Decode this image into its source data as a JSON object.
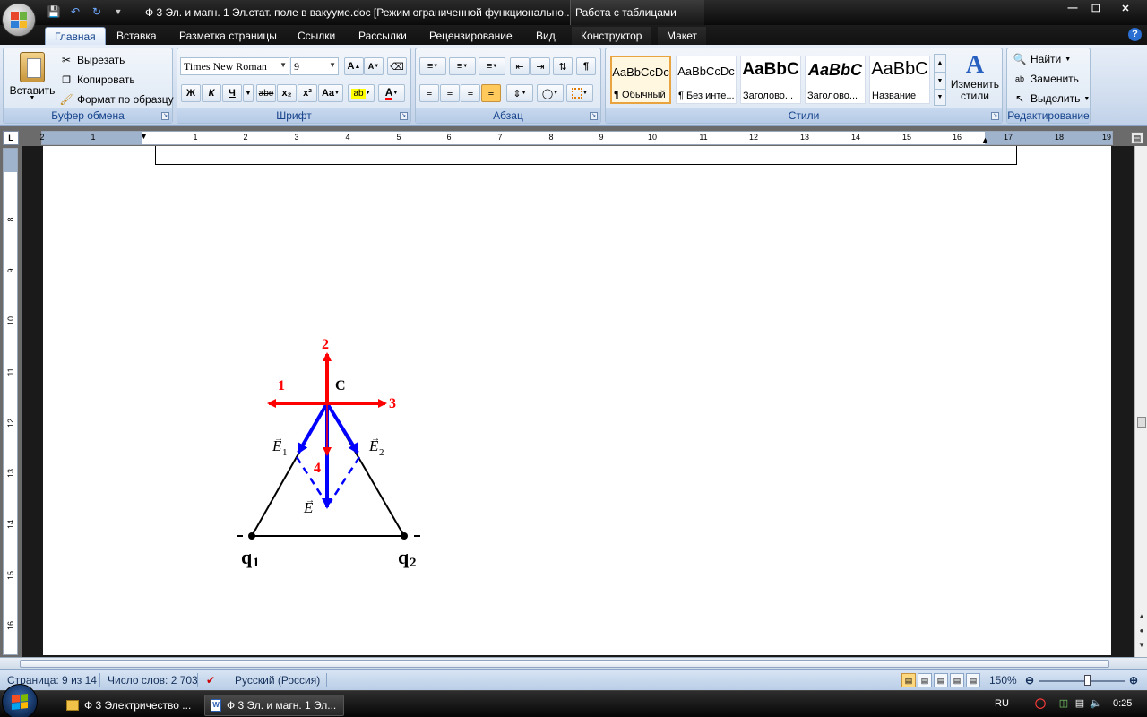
{
  "window": {
    "title": "Ф 3 Эл. и магн. 1 Эл.стат. поле в вакууме.doc [Режим ограниченной функционально...",
    "context_tab_group": "Работа с таблицами"
  },
  "tabs": [
    "Главная",
    "Вставка",
    "Разметка страницы",
    "Ссылки",
    "Рассылки",
    "Рецензирование",
    "Вид",
    "Конструктор",
    "Макет"
  ],
  "ribbon": {
    "clipboard": {
      "paste_label": "Вставить",
      "cut_label": "Вырезать",
      "copy_label": "Копировать",
      "format_painter_label": "Формат по образцу",
      "group_label": "Буфер обмена"
    },
    "font": {
      "font_name": "Times New Roman",
      "font_size": "9",
      "group_label": "Шрифт",
      "bold": "Ж",
      "italic": "К",
      "underline": "Ч",
      "strike": "abe",
      "subscript": "x₂",
      "superscript": "x²",
      "change_case": "Aa"
    },
    "paragraph": {
      "group_label": "Абзац"
    },
    "styles": {
      "items": [
        {
          "sample": "AaBbCcDc",
          "name": "¶ Обычный"
        },
        {
          "sample": "AaBbCcDc",
          "name": "¶ Без инте..."
        },
        {
          "sample": "AaBbC",
          "name": "Заголово..."
        },
        {
          "sample": "AaBbC",
          "name": "Заголово..."
        },
        {
          "sample": "AaBbC",
          "name": "Название"
        }
      ],
      "change_styles_label": "Изменить стили",
      "group_label": "Стили"
    },
    "editing": {
      "find_label": "Найти",
      "replace_label": "Заменить",
      "select_label": "Выделить",
      "group_label": "Редактирование"
    }
  },
  "ruler": {
    "h_numbers": [
      "2",
      "1",
      "1",
      "2",
      "3",
      "4",
      "5",
      "6",
      "7",
      "8",
      "9",
      "10",
      "11",
      "12",
      "13",
      "14",
      "15",
      "16",
      "17",
      "18",
      "19"
    ],
    "v_numbers": [
      "8",
      "9",
      "10",
      "11",
      "12",
      "13",
      "14",
      "15",
      "16"
    ],
    "tab_selector": "L"
  },
  "figure": {
    "labels": {
      "arrow1": "1",
      "arrow2": "2",
      "arrow3": "3",
      "arrow4": "4",
      "point_c": "C",
      "e1": "E",
      "e1_sub": "1",
      "e2": "E",
      "e2_sub": "2",
      "e_total": "E",
      "q1": "q",
      "q1_sub": "1",
      "q2": "q",
      "q2_sub": "2"
    },
    "colors": {
      "red": "#ff0000",
      "blue": "#0000ff",
      "black": "#000000"
    }
  },
  "statusbar": {
    "page": "Страница: 9 из 14",
    "words": "Число слов: 2 703",
    "language": "Русский (Россия)",
    "zoom": "150%"
  },
  "taskbar": {
    "items": [
      "Ф 3 Электричество ...",
      "Ф 3 Эл. и магн. 1 Эл..."
    ],
    "lang": "RU",
    "time": "0:25"
  }
}
